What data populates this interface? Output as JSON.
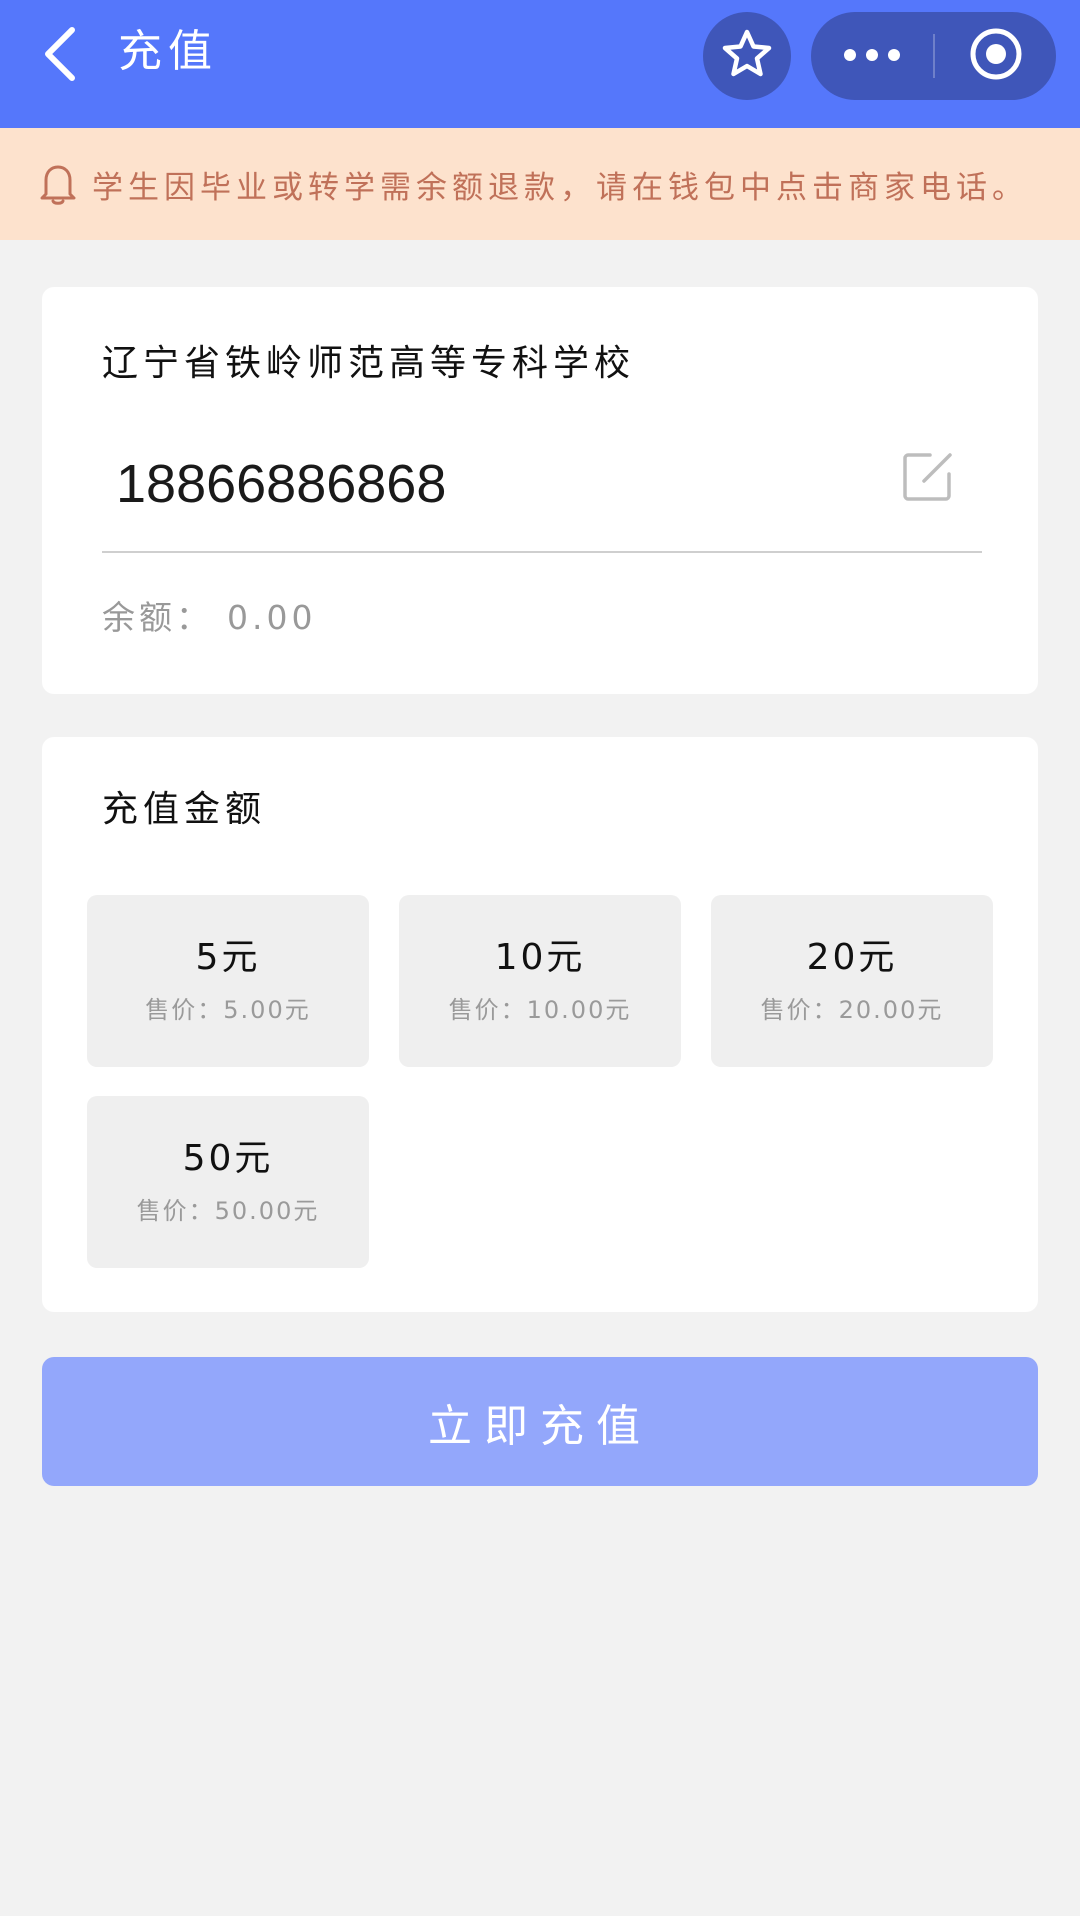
{
  "header": {
    "title": "充值"
  },
  "notice": {
    "text": "学生因毕业或转学需余额退款，请在钱包中点击商家电话。"
  },
  "account": {
    "school_name": "辽宁省铁岭师范高等专科学校",
    "phone": "18866886868",
    "balance_label": "余额：",
    "balance_value": "0.00"
  },
  "amount": {
    "title": "充值金额",
    "options": [
      {
        "label": "5元",
        "price": "售价：5.00元"
      },
      {
        "label": "10元",
        "price": "售价：10.00元"
      },
      {
        "label": "20元",
        "price": "售价：20.00元"
      },
      {
        "label": "50元",
        "price": "售价：50.00元"
      }
    ]
  },
  "submit": {
    "label": "立即充值"
  },
  "colors": {
    "header_bg": "#5577fb",
    "capsule_bg": "#3f56b9",
    "notice_bg": "#fde2cd",
    "notice_text": "#c07159",
    "submit_bg": "#93a7fb"
  },
  "icons": {
    "back": "back-arrow-icon",
    "star": "star-icon",
    "more": "more-dots-icon",
    "target": "target-icon",
    "notice": "bell-icon",
    "edit": "edit-icon"
  }
}
